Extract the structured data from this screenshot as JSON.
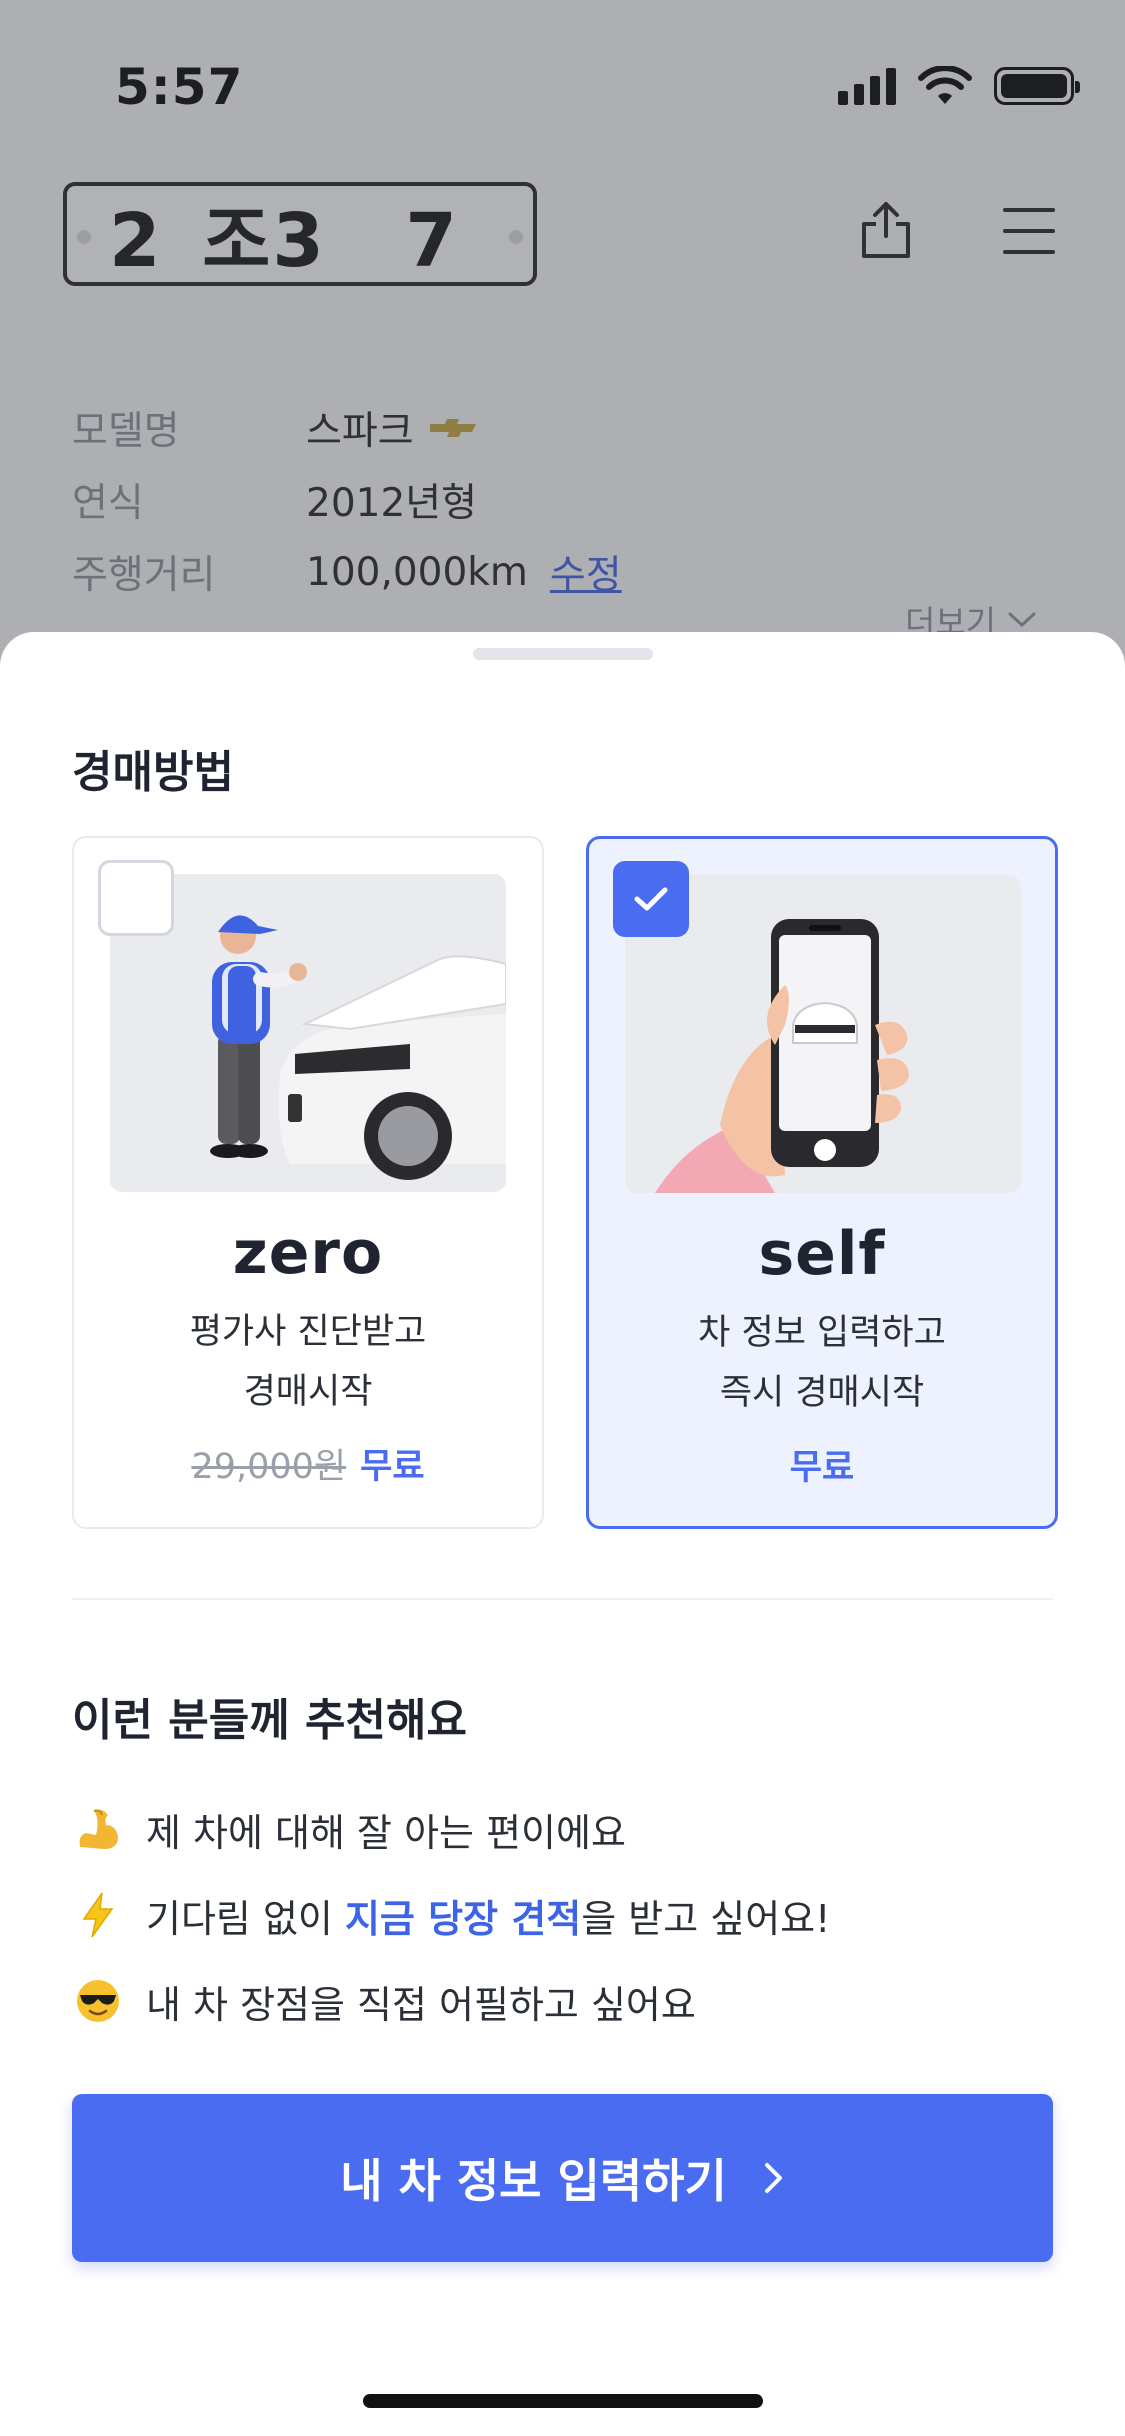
{
  "status": {
    "time": "5:57"
  },
  "header": {
    "plate": "2 조3  7",
    "share_icon": "share-icon",
    "menu_icon": "menu-icon"
  },
  "car_info": {
    "rows": [
      {
        "label": "모델명",
        "value": "스파크"
      },
      {
        "label": "연식",
        "value": "2012년형"
      },
      {
        "label": "주행거리",
        "value": "100,000km",
        "link": "수정"
      }
    ],
    "more": "더보기"
  },
  "sheet": {
    "auction_title": "경매방법",
    "options": [
      {
        "id": "zero",
        "title": "zero",
        "desc_line1": "평가사 진단받고",
        "desc_line2": "경매시작",
        "original_price": "29,000원",
        "price": "무료",
        "selected": false
      },
      {
        "id": "self",
        "title": "self",
        "desc_line1": "차 정보 입력하고",
        "desc_line2": "즉시 경매시작",
        "price": "무료",
        "selected": true
      }
    ],
    "recommend_title": "이런 분들께 추천해요",
    "recommend_items": [
      {
        "emoji": "flexed-biceps",
        "text": "제 차에 대해 잘 아는 편이에요"
      },
      {
        "emoji": "lightning",
        "pre": "기다림 없이 ",
        "highlight": "지금 당장 견적",
        "post": "을 받고 싶어요!"
      },
      {
        "emoji": "sunglasses-face",
        "text": "내 차 장점을 직접 어필하고 싶어요"
      }
    ],
    "cta_label": "내 차 정보 입력하기"
  },
  "colors": {
    "accent": "#4a6cf0",
    "dim_overlay": "#46484e",
    "highlight_text": "#3d63e6"
  }
}
